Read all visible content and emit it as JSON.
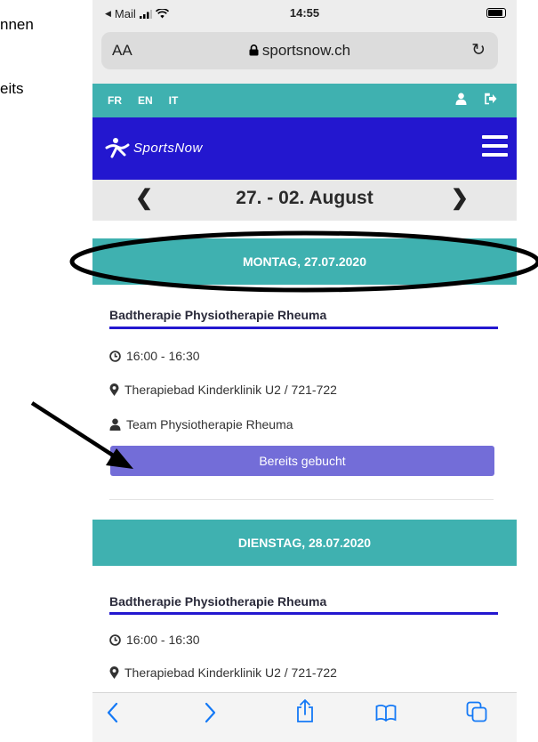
{
  "side_text": [
    "nnen",
    "eits"
  ],
  "status": {
    "carrier": "Mail",
    "time": "14:55"
  },
  "browser": {
    "aa_label": "AA",
    "url": "sportsnow.ch"
  },
  "langs": [
    "FR",
    "EN",
    "IT"
  ],
  "brand": {
    "name": "SportsNow"
  },
  "week": {
    "title": "27. - 02. August"
  },
  "days": [
    {
      "heading": "MONTAG, 27.07.2020",
      "course": "Badtherapie Physiotherapie Rheuma",
      "time": "16:00 - 16:30",
      "location": "Therapiebad Kinderklinik U2 / 721-722",
      "instructor": "Team Physiotherapie Rheuma",
      "button": "Bereits gebucht"
    },
    {
      "heading": "DIENSTAG, 28.07.2020",
      "course": "Badtherapie Physiotherapie Rheuma",
      "time": "16:00 - 16:30",
      "location": "Therapiebad Kinderklinik U2 / 721-722"
    }
  ],
  "colors": {
    "teal": "#3fb1b0",
    "brand_blue": "#2317cf",
    "button_purple": "#736dd8",
    "ios_blue": "#1479f6"
  }
}
